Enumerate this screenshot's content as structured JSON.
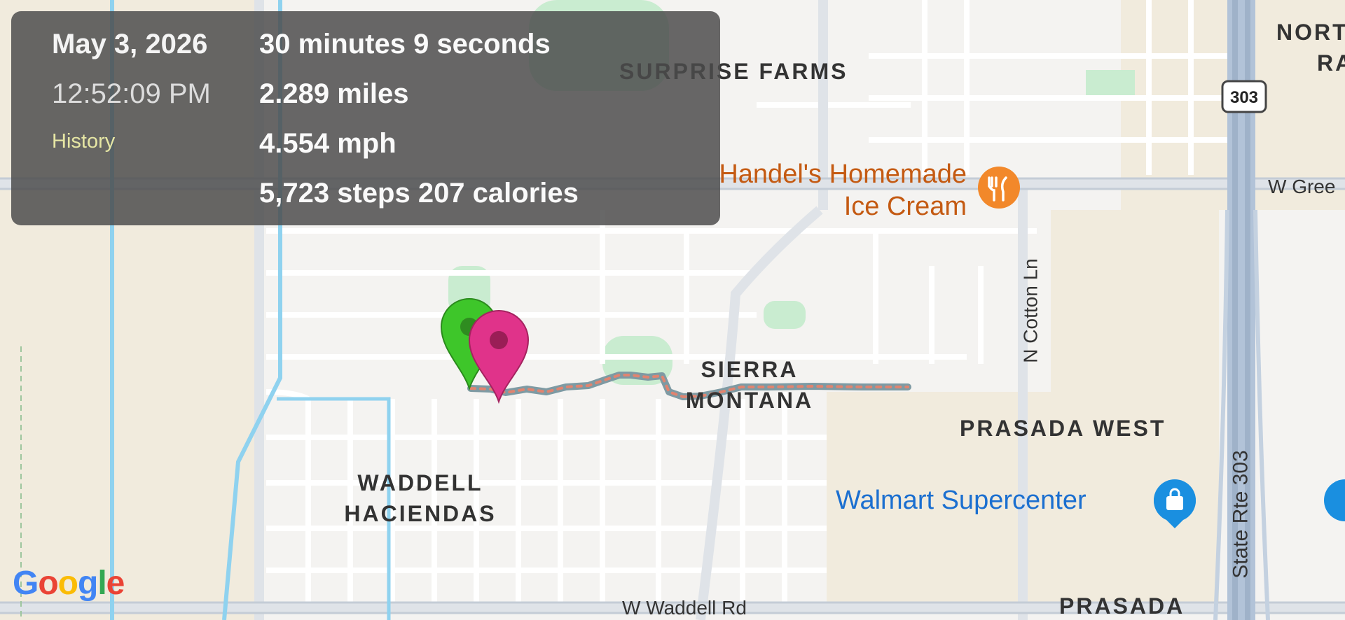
{
  "summary": {
    "date": "May 3, 2026",
    "time": "12:52:09 PM",
    "link": "History",
    "duration": "30 minutes 9 seconds",
    "distance": "2.289 miles",
    "speed": "4.554 mph",
    "steps_calories": "5,723 steps  207 calories"
  },
  "map": {
    "areas": {
      "surprise_farms": "SURPRISE FARMS",
      "sierra_line1": "SIERRA",
      "sierra_line2": "MONTANA",
      "waddell_line1": "WADDELL",
      "waddell_line2": "HACIENDAS",
      "prasada_west": "PRASADA WEST",
      "prasada": "PRASADA",
      "north_line1": "NORT",
      "north_line2": "RA"
    },
    "places": {
      "handels_line1": "Handel's Homemade",
      "handels_line2": "Ice Cream",
      "walmart": "Walmart Supercenter"
    },
    "streets": {
      "waddell_rd": "W Waddell Rd",
      "cotton_ln": "N Cotton Ln",
      "state_rte": "State Rte 303",
      "w_green": "W Gree",
      "shield": "303"
    },
    "markers": {
      "start_color": "#3ec62a",
      "end_color": "#e0338a"
    },
    "route_color": "#7e9aa3",
    "route_dash_color": "#e08470"
  },
  "branding": {
    "logo": "Google"
  }
}
